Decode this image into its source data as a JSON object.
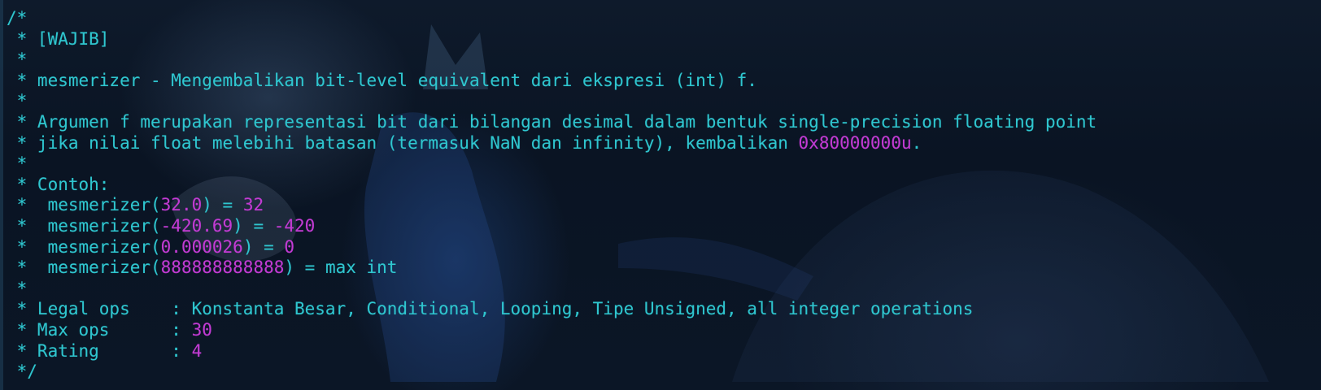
{
  "comment": {
    "open": "/*",
    "tag": " * [WAJIB]",
    "blank1": " *",
    "summary": " * mesmerizer - Mengembalikan bit-level equivalent dari ekspresi (int) f.",
    "blank2": " *",
    "desc_line1": " * Argumen f merupakan representasi bit dari bilangan desimal dalam bentuk single-precision floating point",
    "desc_line2_prefix": " * jika nilai float melebihi batasan (termasuk NaN dan infinity), kembalikan ",
    "desc_line2_value": "0x80000000u",
    "desc_line2_suffix": ".",
    "blank3": " *",
    "example_heading": " * Contoh:",
    "examples": [
      {
        "prefix": " *  mesmerizer(",
        "arg": "32.0",
        "mid": ") = ",
        "result": "32",
        "result_is_number": true
      },
      {
        "prefix": " *  mesmerizer(",
        "arg": "-420.69",
        "mid": ") = ",
        "result": "-420",
        "result_is_number": true
      },
      {
        "prefix": " *  mesmerizer(",
        "arg": "0.000026",
        "mid": ") = ",
        "result": "0",
        "result_is_number": true
      },
      {
        "prefix": " *  mesmerizer(",
        "arg": "888888888888",
        "mid": ") = ",
        "result": "max int",
        "result_is_number": false
      }
    ],
    "blank4": " *",
    "legal_ops": " * Legal ops    : Konstanta Besar, Conditional, Looping, Tipe Unsigned, all integer operations",
    "max_ops_label": " * Max ops      : ",
    "max_ops_value": "30",
    "rating_label": " * Rating       : ",
    "rating_value": "4",
    "close": " */"
  },
  "colors": {
    "comment_text": "#2fc6cf",
    "number_literal": "#c23bd3",
    "background": "#0b1524"
  }
}
